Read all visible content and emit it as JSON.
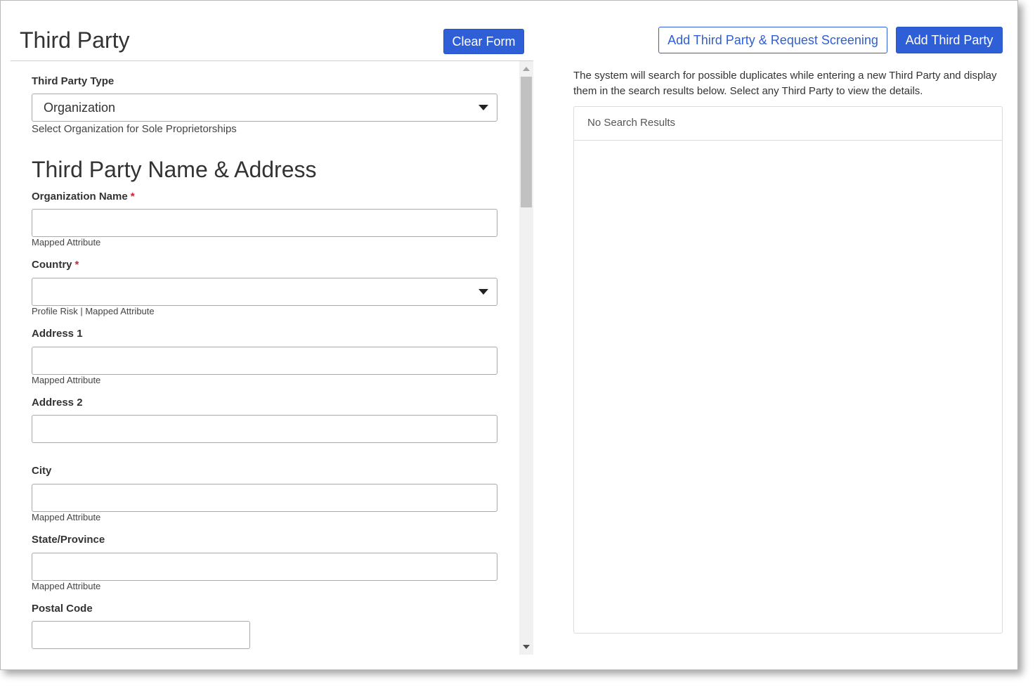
{
  "header": {
    "title": "Third Party",
    "clear_label": "Clear Form"
  },
  "actions": {
    "add_and_screen_label": "Add Third Party & Request Screening",
    "add_label": "Add Third Party"
  },
  "form": {
    "type_label": "Third Party Type",
    "type_value": "Organization",
    "type_hint": "Select Organization for Sole Proprietorships",
    "section_title": "Third Party Name & Address",
    "org_name_label": "Organization Name",
    "org_name_required": "*",
    "org_name_hint": "Mapped Attribute",
    "org_name_value": "",
    "country_label": "Country",
    "country_required": "*",
    "country_value": "",
    "country_hint": "Profile Risk | Mapped Attribute",
    "address1_label": "Address 1",
    "address1_value": "",
    "address1_hint": "Mapped Attribute",
    "address2_label": "Address 2",
    "address2_value": "",
    "city_label": "City",
    "city_value": "",
    "city_hint": "Mapped Attribute",
    "state_label": "State/Province",
    "state_value": "",
    "state_hint": "Mapped Attribute",
    "postal_label": "Postal Code",
    "postal_value": ""
  },
  "search": {
    "info": "The system will search for possible duplicates while entering a new Third Party and display them in the search results below. Select any Third Party to view the details.",
    "empty": "No Search Results"
  },
  "colors": {
    "primary": "#2f5fd6",
    "required": "#d0213b"
  },
  "icons": {
    "dropdown": "caret-down-icon",
    "scroll_up": "triangle-up-icon",
    "scroll_down": "triangle-down-icon"
  }
}
